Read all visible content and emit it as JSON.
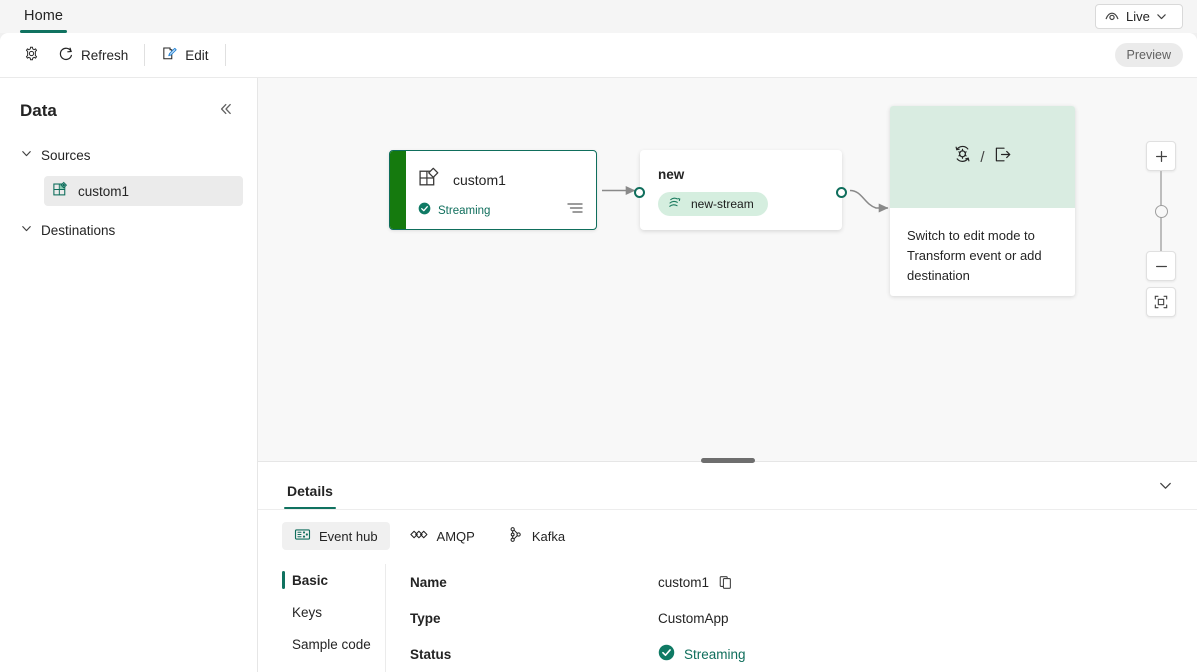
{
  "titlebar": {
    "home_tab": "Home",
    "live_button": {
      "label": "Live",
      "icon": "eye-icon",
      "caret": "chevron-down-icon"
    }
  },
  "commandbar": {
    "settings_icon": "gear-icon",
    "refresh": {
      "label": "Refresh",
      "icon": "refresh-icon"
    },
    "edit": {
      "label": "Edit",
      "icon": "edit-pencil-icon"
    },
    "preview_pill": "Preview"
  },
  "sidebar": {
    "title": "Data",
    "collapse_icon": "double-chevron-left-icon",
    "groups": [
      {
        "label": "Sources",
        "expanded": true,
        "items": [
          {
            "label": "custom1",
            "icon": "customapp-icon",
            "selected": true
          }
        ]
      },
      {
        "label": "Destinations",
        "expanded": true,
        "items": []
      }
    ]
  },
  "canvas": {
    "nodes": {
      "source": {
        "title": "custom1",
        "icon": "customapp-icon",
        "status": "Streaming",
        "status_icon": "checkmark-circle-icon",
        "menu_icon": "menu-lines-icon"
      },
      "stream": {
        "title": "new",
        "chip_label": "new-stream",
        "chip_icon": "eventstream-icon"
      },
      "placeholder": {
        "icon_transform": "transform-event-icon",
        "separator": "/",
        "icon_destination": "add-destination-icon",
        "text": "Switch to edit mode to Transform event or add destination"
      }
    },
    "zoom_controls": {
      "zoom_in": "plus-icon",
      "slider": "zoom-slider",
      "zoom_out": "minus-icon",
      "fit": "fit-to-screen-icon"
    }
  },
  "details": {
    "tab_label": "Details",
    "collapse_icon": "chevron-down-icon",
    "protocol_tabs": [
      {
        "label": "Event hub",
        "icon": "event-hub-icon",
        "selected": true
      },
      {
        "label": "AMQP",
        "icon": "amqp-icon",
        "selected": false
      },
      {
        "label": "Kafka",
        "icon": "kafka-icon",
        "selected": false
      }
    ],
    "side_nav": [
      {
        "label": "Basic",
        "selected": true
      },
      {
        "label": "Keys",
        "selected": false
      },
      {
        "label": "Sample code",
        "selected": false
      }
    ],
    "fields": [
      {
        "key": "Name",
        "value": "custom1",
        "copy_icon": "copy-icon"
      },
      {
        "key": "Type",
        "value": "CustomApp"
      },
      {
        "key": "Status",
        "value": "Streaming",
        "status_icon": "checkmark-circle-icon"
      }
    ]
  },
  "colors": {
    "accent_teal": "#107260",
    "source_green": "#157a0e",
    "chip_green_bg": "#d5eedf",
    "placeholder_green_bg": "#d9ece1"
  }
}
